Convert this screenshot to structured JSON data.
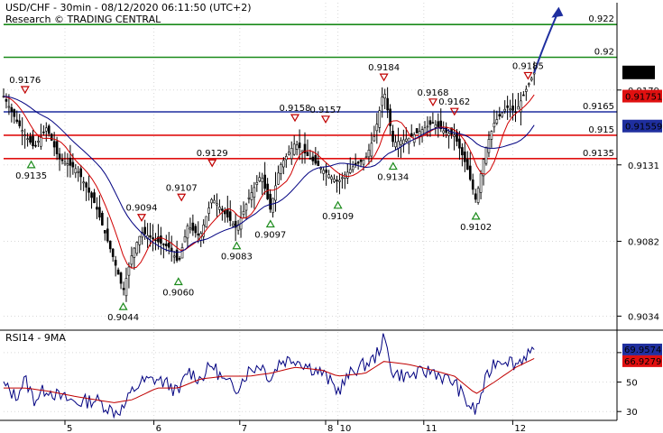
{
  "chart_data": [
    {
      "type": "candlestick",
      "title": "USD/CHF - 30min - 08/12/2020 06:11:50 (UTC+2)",
      "subtitle": "Research © TRADING CENTRAL",
      "x_labels": [
        "5",
        "6",
        "7",
        "8",
        "10",
        "11",
        "12"
      ],
      "y_tick_labels": [
        "0.9179",
        "0.9131",
        "0.9082",
        "0.9034"
      ],
      "ylim": [
        0.9025,
        0.9235
      ],
      "last_price": "0.919",
      "ma_tags": [
        "0.91751",
        "0.91559"
      ],
      "levels": [
        {
          "label": "0.922",
          "value": 0.9221,
          "color": "#1a8a1a"
        },
        {
          "label": "0.92",
          "value": 0.92,
          "color": "#1a8a1a"
        },
        {
          "label": "0.9165",
          "value": 0.9165,
          "color": "#1f2f9f"
        },
        {
          "label": "0.915",
          "value": 0.915,
          "color": "#e01010"
        },
        {
          "label": "0.9135",
          "value": 0.9135,
          "color": "#e01010"
        }
      ],
      "swing_points": [
        {
          "label": "0.9176",
          "kind": "high",
          "t": 0.035,
          "value": 0.9176
        },
        {
          "label": "0.9135",
          "kind": "low",
          "t": 0.045,
          "value": 0.9135
        },
        {
          "label": "0.9094",
          "kind": "high",
          "t": 0.225,
          "value": 0.9094
        },
        {
          "label": "0.9044",
          "kind": "low",
          "t": 0.195,
          "value": 0.9044
        },
        {
          "label": "0.9107",
          "kind": "high",
          "t": 0.29,
          "value": 0.9107
        },
        {
          "label": "0.9060",
          "kind": "low",
          "t": 0.285,
          "value": 0.906
        },
        {
          "label": "0.9129",
          "kind": "high",
          "t": 0.34,
          "value": 0.9129
        },
        {
          "label": "0.9083",
          "kind": "low",
          "t": 0.38,
          "value": 0.9083
        },
        {
          "label": "0.9097",
          "kind": "low",
          "t": 0.435,
          "value": 0.9097
        },
        {
          "label": "0.9158",
          "kind": "high",
          "t": 0.475,
          "value": 0.9158
        },
        {
          "label": "0.9157",
          "kind": "high",
          "t": 0.525,
          "value": 0.9157
        },
        {
          "label": "0.9109",
          "kind": "low",
          "t": 0.545,
          "value": 0.9109
        },
        {
          "label": "0.9184",
          "kind": "high",
          "t": 0.62,
          "value": 0.9184
        },
        {
          "label": "0.9134",
          "kind": "low",
          "t": 0.635,
          "value": 0.9134
        },
        {
          "label": "0.9168",
          "kind": "high",
          "t": 0.7,
          "value": 0.9168
        },
        {
          "label": "0.9162",
          "kind": "high",
          "t": 0.735,
          "value": 0.9162
        },
        {
          "label": "0.9102",
          "kind": "low",
          "t": 0.77,
          "value": 0.9102
        },
        {
          "label": "0.9185",
          "kind": "high",
          "t": 0.855,
          "value": 0.9185
        }
      ],
      "close_path": [
        [
          0.0,
          0.9175
        ],
        [
          0.02,
          0.916
        ],
        [
          0.035,
          0.915
        ],
        [
          0.05,
          0.9142
        ],
        [
          0.07,
          0.9155
        ],
        [
          0.09,
          0.9135
        ],
        [
          0.12,
          0.9128
        ],
        [
          0.15,
          0.9105
        ],
        [
          0.18,
          0.907
        ],
        [
          0.195,
          0.905
        ],
        [
          0.21,
          0.9075
        ],
        [
          0.225,
          0.9088
        ],
        [
          0.25,
          0.9082
        ],
        [
          0.27,
          0.9078
        ],
        [
          0.285,
          0.9068
        ],
        [
          0.3,
          0.9092
        ],
        [
          0.32,
          0.9085
        ],
        [
          0.34,
          0.911
        ],
        [
          0.36,
          0.91
        ],
        [
          0.38,
          0.909
        ],
        [
          0.4,
          0.911
        ],
        [
          0.42,
          0.9125
        ],
        [
          0.435,
          0.9102
        ],
        [
          0.45,
          0.913
        ],
        [
          0.475,
          0.9145
        ],
        [
          0.5,
          0.9135
        ],
        [
          0.52,
          0.9128
        ],
        [
          0.545,
          0.912
        ],
        [
          0.57,
          0.913
        ],
        [
          0.59,
          0.9135
        ],
        [
          0.605,
          0.915
        ],
        [
          0.62,
          0.918
        ],
        [
          0.635,
          0.9145
        ],
        [
          0.66,
          0.9148
        ],
        [
          0.7,
          0.9158
        ],
        [
          0.72,
          0.9152
        ],
        [
          0.735,
          0.915
        ],
        [
          0.755,
          0.913
        ],
        [
          0.77,
          0.9108
        ],
        [
          0.785,
          0.914
        ],
        [
          0.8,
          0.9158
        ],
        [
          0.82,
          0.9168
        ],
        [
          0.835,
          0.9165
        ],
        [
          0.855,
          0.9182
        ],
        [
          0.865,
          0.919
        ]
      ],
      "forecast_arrow": [
        [
          0.865,
          0.919
        ],
        [
          0.905,
          0.923
        ]
      ]
    },
    {
      "type": "line",
      "title": "RSI14 - 9MA",
      "y_tick_labels": [
        "70",
        "50",
        "30"
      ],
      "ylim": [
        24,
        84
      ],
      "value_tags": [
        "69.9574",
        "66.9279"
      ],
      "series": [
        {
          "color": "#000080",
          "values": [
            [
              0.0,
              48
            ],
            [
              0.02,
              40
            ],
            [
              0.035,
              52
            ],
            [
              0.05,
              38
            ],
            [
              0.07,
              46
            ],
            [
              0.09,
              40
            ],
            [
              0.12,
              36
            ],
            [
              0.15,
              38
            ],
            [
              0.18,
              30
            ],
            [
              0.195,
              32
            ],
            [
              0.21,
              44
            ],
            [
              0.225,
              50
            ],
            [
              0.25,
              52
            ],
            [
              0.27,
              48
            ],
            [
              0.285,
              42
            ],
            [
              0.3,
              58
            ],
            [
              0.32,
              52
            ],
            [
              0.34,
              62
            ],
            [
              0.36,
              50
            ],
            [
              0.38,
              46
            ],
            [
              0.4,
              58
            ],
            [
              0.42,
              62
            ],
            [
              0.435,
              52
            ],
            [
              0.45,
              64
            ],
            [
              0.475,
              66
            ],
            [
              0.5,
              60
            ],
            [
              0.52,
              56
            ],
            [
              0.545,
              44
            ],
            [
              0.57,
              58
            ],
            [
              0.59,
              62
            ],
            [
              0.605,
              66
            ],
            [
              0.62,
              80
            ],
            [
              0.635,
              56
            ],
            [
              0.66,
              54
            ],
            [
              0.7,
              58
            ],
            [
              0.72,
              52
            ],
            [
              0.735,
              50
            ],
            [
              0.755,
              36
            ],
            [
              0.77,
              30
            ],
            [
              0.785,
              50
            ],
            [
              0.8,
              64
            ],
            [
              0.82,
              66
            ],
            [
              0.835,
              62
            ],
            [
              0.855,
              70
            ],
            [
              0.865,
              68
            ]
          ]
        },
        {
          "color": "#c00000",
          "values": [
            [
              0.0,
              46
            ],
            [
              0.035,
              46
            ],
            [
              0.07,
              44
            ],
            [
              0.12,
              40
            ],
            [
              0.18,
              36
            ],
            [
              0.21,
              38
            ],
            [
              0.25,
              46
            ],
            [
              0.285,
              46
            ],
            [
              0.32,
              52
            ],
            [
              0.36,
              54
            ],
            [
              0.4,
              54
            ],
            [
              0.435,
              56
            ],
            [
              0.475,
              60
            ],
            [
              0.52,
              58
            ],
            [
              0.545,
              54
            ],
            [
              0.59,
              56
            ],
            [
              0.62,
              64
            ],
            [
              0.66,
              62
            ],
            [
              0.7,
              58
            ],
            [
              0.735,
              54
            ],
            [
              0.77,
              42
            ],
            [
              0.8,
              50
            ],
            [
              0.835,
              60
            ],
            [
              0.865,
              66
            ]
          ]
        }
      ]
    }
  ]
}
